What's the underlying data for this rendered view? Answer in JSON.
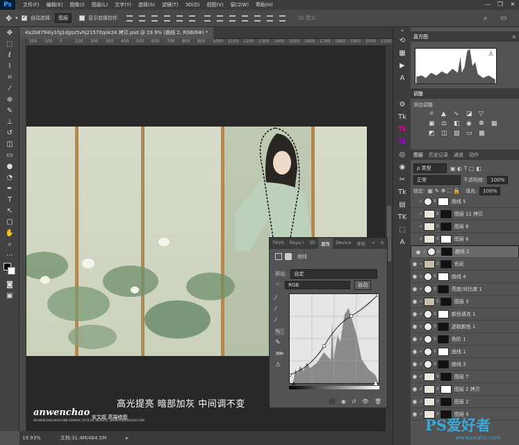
{
  "menubar": {
    "logo": "Ps",
    "items": [
      "文件(F)",
      "编辑(E)",
      "图像(I)",
      "图层(L)",
      "文字(Y)",
      "选择(S)",
      "滤镜(T)",
      "3D(D)",
      "视图(V)",
      "窗口(W)",
      "帮助(H)"
    ],
    "controls": [
      "—",
      "❐",
      "✕"
    ]
  },
  "optionsbar": {
    "auto_select_label": "自动选择:",
    "auto_select_value": "图层",
    "transform_label": "显示变换控件",
    "mode_3d_label": "3D 模式:"
  },
  "document": {
    "tab_title": "4a2b8794ly1fg1dgsz5vhj21570qok24 拷贝.psd @ 19.9% (曲线 2, RGB/8#) *",
    "ruler_ticks": [
      "200",
      "100",
      "0",
      "100",
      "200",
      "300",
      "400",
      "500",
      "600",
      "700",
      "800",
      "900",
      "1000",
      "1100",
      "1200",
      "1300",
      "1400",
      "1500",
      "1600",
      "1700",
      "1800",
      "1900",
      "2000",
      "2100",
      "2200"
    ],
    "caption": "高光提亮 暗部加灰 中间调不变",
    "brand": "anwenchao",
    "brand_cn": "安文超 高端修图",
    "brand_sub": "AN WENCHAO HIGH-END GRAPHIC OFFICIAL WEBSITE: WWW.ANWENCHAO.COM"
  },
  "statusbar": {
    "zoom": "19.93%",
    "doc": "文档:31.4M/464.5M"
  },
  "properties": {
    "tabs": [
      "TKVS",
      "Raya I",
      "3D",
      "属性",
      "Device",
      "字形"
    ],
    "active_tab": "属性",
    "title": "曲线",
    "preset_label": "预设:",
    "preset_value": "自定",
    "channel_value": "RGB",
    "auto_button": "自动"
  },
  "histogram_panel": {
    "tabs": [
      "直方图"
    ],
    "title": "直方图"
  },
  "adjustments_panel": {
    "tab": "调整",
    "hint": "添加调整"
  },
  "layers_panel": {
    "tabs": [
      "图层",
      "历史记录",
      "通道",
      "动作"
    ],
    "kind_label": "ρ 类型",
    "blend_mode": "正常",
    "opacity_label": "不透明度:",
    "opacity_value": "100%",
    "lock_label": "锁定:",
    "fill_label": "填充:",
    "fill_value": "100%",
    "layers": [
      {
        "name": "曲线 5",
        "visible": false,
        "type": "adj"
      },
      {
        "name": "图层 11 拷贝",
        "visible": false,
        "type": "pix"
      },
      {
        "name": "图层 8",
        "visible": false,
        "type": "pix"
      },
      {
        "name": "图层 6",
        "visible": false,
        "type": "pix"
      },
      {
        "name": "曲线 2",
        "visible": true,
        "type": "adj",
        "selected": true
      },
      {
        "name": "色彩",
        "visible": true,
        "type": "fill"
      },
      {
        "name": "曲线 4",
        "visible": true,
        "type": "adj"
      },
      {
        "name": "亮度/对比度 1",
        "visible": true,
        "type": "adj"
      },
      {
        "name": "图层 3",
        "visible": true,
        "type": "fill"
      },
      {
        "name": "颜色填充 1",
        "visible": true,
        "type": "adj"
      },
      {
        "name": "选取颜色 1",
        "visible": true,
        "type": "adj"
      },
      {
        "name": "色阶 1",
        "visible": true,
        "type": "adj"
      },
      {
        "name": "曲线 1",
        "visible": true,
        "type": "adj"
      },
      {
        "name": "曲线 3",
        "visible": true,
        "type": "adj"
      },
      {
        "name": "图层 7",
        "visible": true,
        "type": "pix"
      },
      {
        "name": "图层 2 拷贝",
        "visible": true,
        "type": "pix"
      },
      {
        "name": "图层 2",
        "visible": true,
        "type": "pix"
      },
      {
        "name": "图层 4",
        "visible": true,
        "type": "pix"
      }
    ]
  },
  "watermark": {
    "text": "PS爱好者",
    "url": "www.psahz.com"
  },
  "colors": {
    "accent": "#31a8ff",
    "watermark": "#3aa7d7"
  }
}
